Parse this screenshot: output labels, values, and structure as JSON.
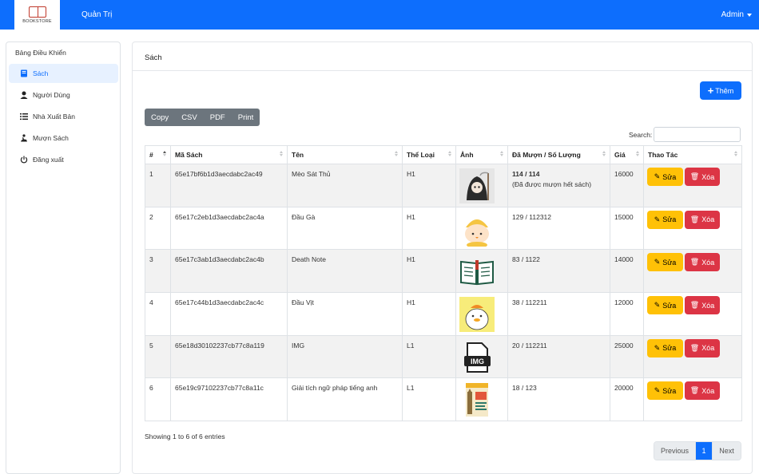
{
  "navbar": {
    "brand_text": "BOOKSTORE",
    "title": "Quản Trị",
    "user": "Admin",
    "bg_color": "#0d6efd"
  },
  "sidebar": {
    "heading": "Bảng Điều Khiển",
    "items": [
      {
        "label": "Sách",
        "icon": "book-icon",
        "active": true
      },
      {
        "label": "Người Dùng",
        "icon": "user-icon",
        "active": false
      },
      {
        "label": "Nhà Xuất Bản",
        "icon": "list-icon",
        "active": false
      },
      {
        "label": "Mượn Sách",
        "icon": "borrow-icon",
        "active": false
      },
      {
        "label": "Đăng xuất",
        "icon": "power-icon",
        "active": false
      }
    ]
  },
  "main": {
    "title": "Sách",
    "add_label": "Thêm",
    "export_buttons": [
      "Copy",
      "CSV",
      "PDF",
      "Print"
    ],
    "search_label": "Search:",
    "search_value": "",
    "columns": [
      "#",
      "Mã Sách",
      "Tên",
      "Thể Loại",
      "Ảnh",
      "Đã Mượn / Số Lượng",
      "Giá",
      "Thao Tác"
    ],
    "rows": [
      {
        "no": "1",
        "id": "65e17bf6b1d3aecdabc2ac49",
        "name": "Mèo Sát Thủ",
        "category": "H1",
        "image": "reaper-cat-image",
        "borrow": "114 / 114",
        "borrow_note": "(Đã được mượn hết sách)",
        "price": "16000"
      },
      {
        "no": "2",
        "id": "65e17c2eb1d3aecdabc2ac4a",
        "name": "Đầu Gà",
        "category": "H1",
        "image": "chick-head-image",
        "borrow": "129 / 112312",
        "borrow_note": "",
        "price": "15000"
      },
      {
        "no": "3",
        "id": "65e17c3ab1d3aecdabc2ac4b",
        "name": "Death Note",
        "category": "H1",
        "image": "open-book-image",
        "borrow": "83 / 1122",
        "borrow_note": "",
        "price": "14000"
      },
      {
        "no": "4",
        "id": "65e17c44b1d3aecdabc2ac4c",
        "name": "Đầu Vịt",
        "category": "H1",
        "image": "duck-image",
        "borrow": "38 / 112211",
        "borrow_note": "",
        "price": "12000"
      },
      {
        "no": "5",
        "id": "65e18d30102237cb77c8a119",
        "name": "IMG",
        "category": "L1",
        "image": "img-placeholder-image",
        "borrow": "20 / 112211",
        "borrow_note": "",
        "price": "25000"
      },
      {
        "no": "6",
        "id": "65e19c97102237cb77c8a11c",
        "name": "Giải tích ngữ pháp tiếng anh",
        "category": "L1",
        "image": "grammar-book-cover-image",
        "borrow": "18 / 123",
        "borrow_note": "",
        "price": "20000"
      }
    ],
    "edit_label": "Sửa",
    "delete_label": "Xóa",
    "info": "Showing 1 to 6 of 6 entries",
    "pagination": {
      "prev": "Previous",
      "current": "1",
      "next": "Next"
    }
  }
}
